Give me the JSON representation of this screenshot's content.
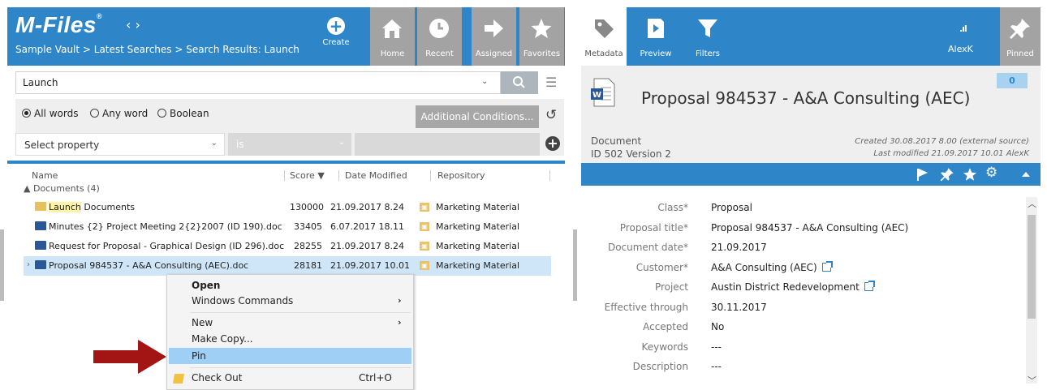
{
  "left": {
    "brand": "M-Files",
    "brand_mark": "®",
    "nav_arrows": "‹ ›",
    "breadcrumb": "Sample Vault > Latest Searches > Search Results: Launch",
    "create_label": "Create",
    "nav_tabs": [
      {
        "label": "Home",
        "icon": "home-icon"
      },
      {
        "label": "Recent",
        "icon": "clock-icon"
      },
      {
        "label": "Assigned",
        "icon": "arrow-right-icon"
      },
      {
        "label": "Favorites",
        "icon": "star-icon"
      }
    ]
  },
  "search": {
    "value": "Launch",
    "dropdown": "⌄",
    "options_icon": "sliders-icon"
  },
  "options": {
    "radios": [
      {
        "label": "All words",
        "checked": true
      },
      {
        "label": "Any word",
        "checked": false
      },
      {
        "label": "Boolean",
        "checked": false
      }
    ],
    "additional_conditions": "Additional Conditions...",
    "property_placeholder": "Select property",
    "operator": "is"
  },
  "list": {
    "columns": [
      "Name",
      "Score",
      "Date Modified",
      "Repository"
    ],
    "group_label": "Documents (4)",
    "rows": [
      {
        "name_highlight": "Launch",
        "name_rest": " Documents",
        "icon": "folder-icon",
        "score": "130000",
        "date": "21.09.2017 8.24",
        "repository": "Marketing Material",
        "selected": false
      },
      {
        "name_highlight": "",
        "name_rest": "Minutes {2} Project Meeting 2{2}2007 (ID 190).doc",
        "icon": "word-doc-icon",
        "score": "33405",
        "date": "6.07.2017 18.11",
        "repository": "Marketing Material",
        "selected": false
      },
      {
        "name_highlight": "",
        "name_rest": "Request for Proposal - Graphical Design (ID 296).doc",
        "icon": "word-doc-icon",
        "score": "28255",
        "date": "21.09.2017 8.24",
        "repository": "Marketing Material",
        "selected": false
      },
      {
        "name_highlight": "",
        "name_rest": "Proposal 984537 - A&A Consulting (AEC).doc",
        "icon": "word-doc-icon",
        "score": "28181",
        "date": "21.09.2017 10.01",
        "repository": "Marketing Material",
        "selected": true
      }
    ]
  },
  "context_menu": {
    "items": [
      {
        "label": "Open",
        "bold": true
      },
      {
        "label": "Windows Commands",
        "submenu": "›"
      },
      {
        "label": "New",
        "submenu": "›"
      },
      {
        "label": "Make Copy..."
      },
      {
        "label": "Pin",
        "highlighted": true
      },
      {
        "label": "Check Out",
        "shortcut": "Ctrl+O"
      }
    ]
  },
  "right": {
    "tabs": [
      {
        "label": "Metadata",
        "icon": "tag-icon",
        "active": true
      },
      {
        "label": "Preview",
        "icon": "preview-icon"
      },
      {
        "label": "Filters",
        "icon": "filter-icon"
      }
    ],
    "signal": ".ıl",
    "user": "AlexK",
    "pinned_label": "Pinned",
    "title": "Proposal 984537 - A&A Consulting (AEC)",
    "badge_count": "0",
    "doc_type": "Document",
    "doc_id": "ID 502  Version 2",
    "created": "Created 30.08.2017 8.00 (external source)",
    "modified": "Last modified 21.09.2017 10.01 AlexK",
    "toolbar_icons": [
      "flag-icon",
      "pin-icon",
      "star-icon",
      "gear-icon",
      "chevron-up-icon"
    ]
  },
  "properties": [
    {
      "label": "Class*",
      "value": "Proposal",
      "link": false
    },
    {
      "label": "Proposal title*",
      "value": "Proposal 984537 - A&A Consulting (AEC)",
      "link": false
    },
    {
      "label": "Document date*",
      "value": "21.09.2017",
      "link": false
    },
    {
      "label": "Customer*",
      "value": "A&A Consulting (AEC)",
      "link": true
    },
    {
      "label": "Project",
      "value": "Austin District Redevelopment",
      "link": true
    },
    {
      "label": "Effective through",
      "value": "30.11.2017",
      "link": false
    },
    {
      "label": "Accepted",
      "value": "No",
      "link": false
    },
    {
      "label": "Keywords",
      "value": "---",
      "link": false
    },
    {
      "label": "Description",
      "value": "---",
      "link": false
    }
  ],
  "colors": {
    "accent": "#2e86c9",
    "selection": "#cfe6f8",
    "menu_hover": "#9fcff5",
    "annotation_arrow": "#a31515"
  }
}
